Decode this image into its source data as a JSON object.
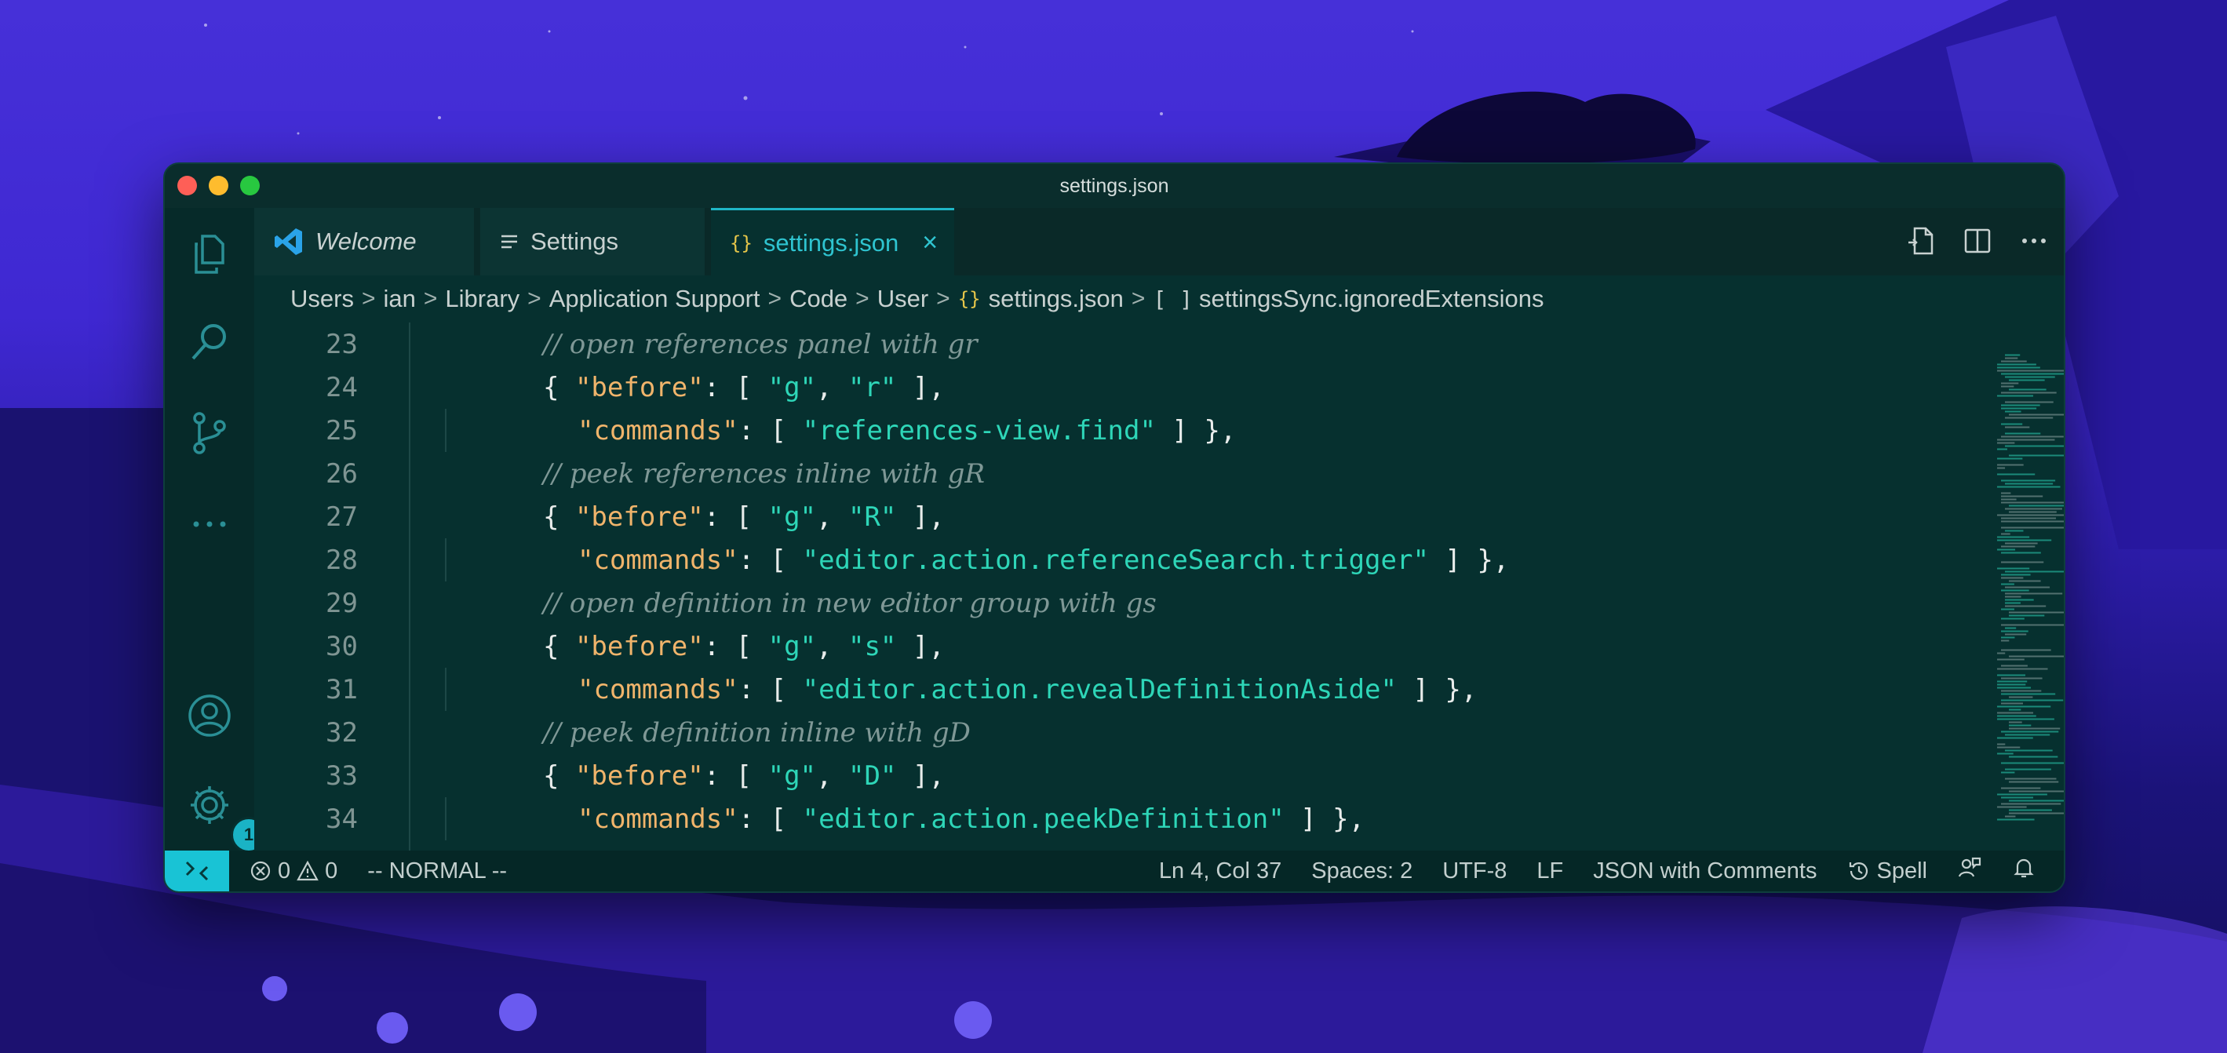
{
  "window": {
    "title": "settings.json"
  },
  "tabs": [
    {
      "label": "Welcome",
      "icon": "vscode-logo-icon"
    },
    {
      "label": "Settings",
      "icon": "settings-list-icon"
    },
    {
      "label": "settings.json",
      "icon": "json-braces-icon",
      "active": true
    }
  ],
  "breadcrumb": {
    "items": [
      "Users",
      "ian",
      "Library",
      "Application Support",
      "Code",
      "User"
    ],
    "file": "settings.json",
    "symbol": "settingsSync.ignoredExtensions",
    "separator": ">",
    "file_glyph": "{}",
    "symbol_glyph": "[ ]"
  },
  "activity_bar": {
    "items": [
      "explorer-icon",
      "search-icon",
      "source-control-icon",
      "more-icon",
      "accounts-icon",
      "manage-gear-icon"
    ],
    "settings_badge": "1"
  },
  "editor": {
    "lines": [
      {
        "num": "23",
        "segs": [
          {
            "t": "c",
            "v": "// open references panel with gr"
          }
        ]
      },
      {
        "num": "24",
        "segs": [
          {
            "t": "p",
            "v": "{ "
          },
          {
            "t": "k",
            "v": "\"before\""
          },
          {
            "t": "p",
            "v": ": [ "
          },
          {
            "t": "s",
            "v": "\"g\""
          },
          {
            "t": "p",
            "v": ", "
          },
          {
            "t": "s",
            "v": "\"r\""
          },
          {
            "t": "p",
            "v": " ],"
          }
        ]
      },
      {
        "num": "25",
        "segs": [
          {
            "t": "k",
            "v": "\"commands\""
          },
          {
            "t": "p",
            "v": ": [ "
          },
          {
            "t": "s",
            "v": "\"references-view.find\""
          },
          {
            "t": "p",
            "v": " ] },"
          }
        ]
      },
      {
        "num": "26",
        "segs": [
          {
            "t": "c",
            "v": "// peek references inline with gR"
          }
        ]
      },
      {
        "num": "27",
        "segs": [
          {
            "t": "p",
            "v": "{ "
          },
          {
            "t": "k",
            "v": "\"before\""
          },
          {
            "t": "p",
            "v": ": [ "
          },
          {
            "t": "s",
            "v": "\"g\""
          },
          {
            "t": "p",
            "v": ", "
          },
          {
            "t": "s",
            "v": "\"R\""
          },
          {
            "t": "p",
            "v": " ],"
          }
        ]
      },
      {
        "num": "28",
        "segs": [
          {
            "t": "k",
            "v": "\"commands\""
          },
          {
            "t": "p",
            "v": ": [ "
          },
          {
            "t": "s",
            "v": "\"editor.action.referenceSearch.trigger\""
          },
          {
            "t": "p",
            "v": " ] },"
          }
        ]
      },
      {
        "num": "29",
        "segs": [
          {
            "t": "c",
            "v": "// open definition in new editor group with gs"
          }
        ]
      },
      {
        "num": "30",
        "segs": [
          {
            "t": "p",
            "v": "{ "
          },
          {
            "t": "k",
            "v": "\"before\""
          },
          {
            "t": "p",
            "v": ": [ "
          },
          {
            "t": "s",
            "v": "\"g\""
          },
          {
            "t": "p",
            "v": ", "
          },
          {
            "t": "s",
            "v": "\"s\""
          },
          {
            "t": "p",
            "v": " ],"
          }
        ]
      },
      {
        "num": "31",
        "segs": [
          {
            "t": "k",
            "v": "\"commands\""
          },
          {
            "t": "p",
            "v": ": [ "
          },
          {
            "t": "s",
            "v": "\"editor.action.revealDefinitionAside\""
          },
          {
            "t": "p",
            "v": " ] },"
          }
        ]
      },
      {
        "num": "32",
        "segs": [
          {
            "t": "c",
            "v": "// peek definition inline with gD"
          }
        ]
      },
      {
        "num": "33",
        "segs": [
          {
            "t": "p",
            "v": "{ "
          },
          {
            "t": "k",
            "v": "\"before\""
          },
          {
            "t": "p",
            "v": ": [ "
          },
          {
            "t": "s",
            "v": "\"g\""
          },
          {
            "t": "p",
            "v": ", "
          },
          {
            "t": "s",
            "v": "\"D\""
          },
          {
            "t": "p",
            "v": " ],"
          }
        ]
      },
      {
        "num": "34",
        "segs": [
          {
            "t": "k",
            "v": "\"commands\""
          },
          {
            "t": "p",
            "v": ": [ "
          },
          {
            "t": "s",
            "v": "\"editor.action.peekDefinition\""
          },
          {
            "t": "p",
            "v": " ] },"
          }
        ]
      }
    ]
  },
  "status_bar": {
    "errors": "0",
    "warnings": "0",
    "mode": "-- NORMAL --",
    "position": "Ln 4, Col 37",
    "spaces": "Spaces: 2",
    "encoding": "UTF-8",
    "eol": "LF",
    "language": "JSON with Comments",
    "spell": "Spell"
  },
  "colors": {
    "accent": "#1fb6c6",
    "editor_bg": "#06302f",
    "string": "#2ed6b8",
    "key": "#f0b46b",
    "comment": "#7f9896"
  }
}
